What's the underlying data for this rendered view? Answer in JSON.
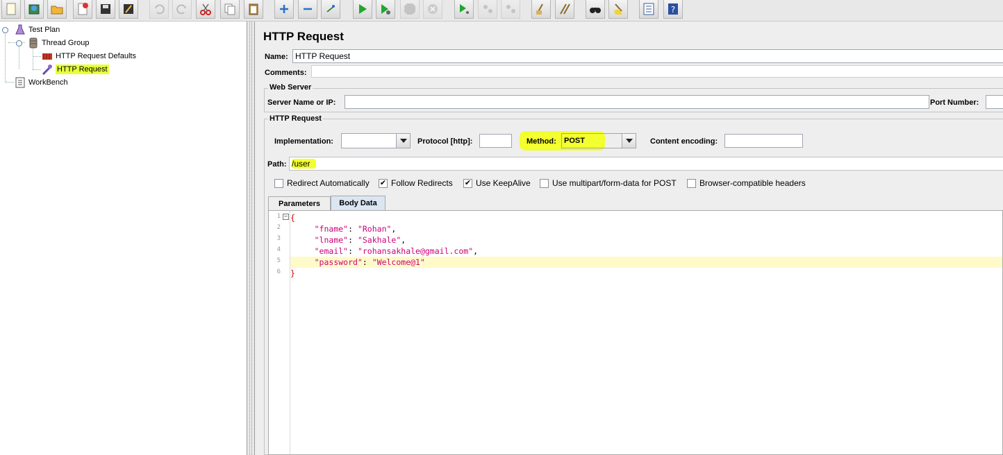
{
  "toolbar": {
    "buttons": [
      "new",
      "templates",
      "open",
      "close",
      "save",
      "save-as",
      "undo",
      "redo",
      "cut",
      "copy",
      "paste",
      "expand",
      "collapse",
      "toggle",
      "start",
      "start-no-pauses",
      "stop",
      "shutdown",
      "remote-start-all",
      "remote-stop-all",
      "remote-exit-all",
      "clear",
      "clear-all",
      "search",
      "reset-search",
      "function-helper",
      "help"
    ]
  },
  "tree": {
    "test_plan": "Test Plan",
    "thread_group": "Thread Group",
    "defaults": "HTTP Request Defaults",
    "http_request": "HTTP Request",
    "workbench": "WorkBench"
  },
  "editor": {
    "title": "HTTP Request",
    "name_label": "Name:",
    "name_value": "HTTP Request",
    "comments_label": "Comments:",
    "web_server": {
      "title": "Web Server",
      "server_label": "Server Name or IP:",
      "server_value": "",
      "port_label": "Port Number:"
    },
    "http_request": {
      "title": "HTTP Request",
      "implementation_label": "Implementation:",
      "implementation_value": "",
      "protocol_label": "Protocol [http]:",
      "protocol_value": "",
      "method_label": "Method:",
      "method_value": "POST",
      "encoding_label": "Content encoding:",
      "encoding_value": "",
      "path_label": "Path:",
      "path_value": "/user"
    },
    "options": [
      {
        "label": "Redirect Automatically",
        "checked": false
      },
      {
        "label": "Follow Redirects",
        "checked": true
      },
      {
        "label": "Use KeepAlive",
        "checked": true
      },
      {
        "label": "Use multipart/form-data for POST",
        "checked": false
      },
      {
        "label": "Browser-compatible headers",
        "checked": false
      }
    ],
    "tabs": {
      "parameters": "Parameters",
      "body_data": "Body Data"
    },
    "body": {
      "line_numbers": [
        "1",
        "2",
        "3",
        "4",
        "5",
        "6"
      ],
      "open_brace": "{",
      "close_brace": "}",
      "fields": [
        {
          "key": "\"fname\"",
          "value": "\"Rohan\"",
          "comma": ","
        },
        {
          "key": "\"lname\"",
          "value": "\"Sakhale\"",
          "comma": ","
        },
        {
          "key": "\"email\"",
          "value": "\"rohansakhale@gmail.com\"",
          "comma": ","
        },
        {
          "key": "\"password\"",
          "value": "\"Welcome@1\"",
          "comma": ""
        }
      ]
    }
  },
  "colors": {
    "highlight": "#f3ff2e",
    "selected_tree": "#e6ff3a",
    "json_key": "#cc0077",
    "brace": "#cc0000"
  }
}
